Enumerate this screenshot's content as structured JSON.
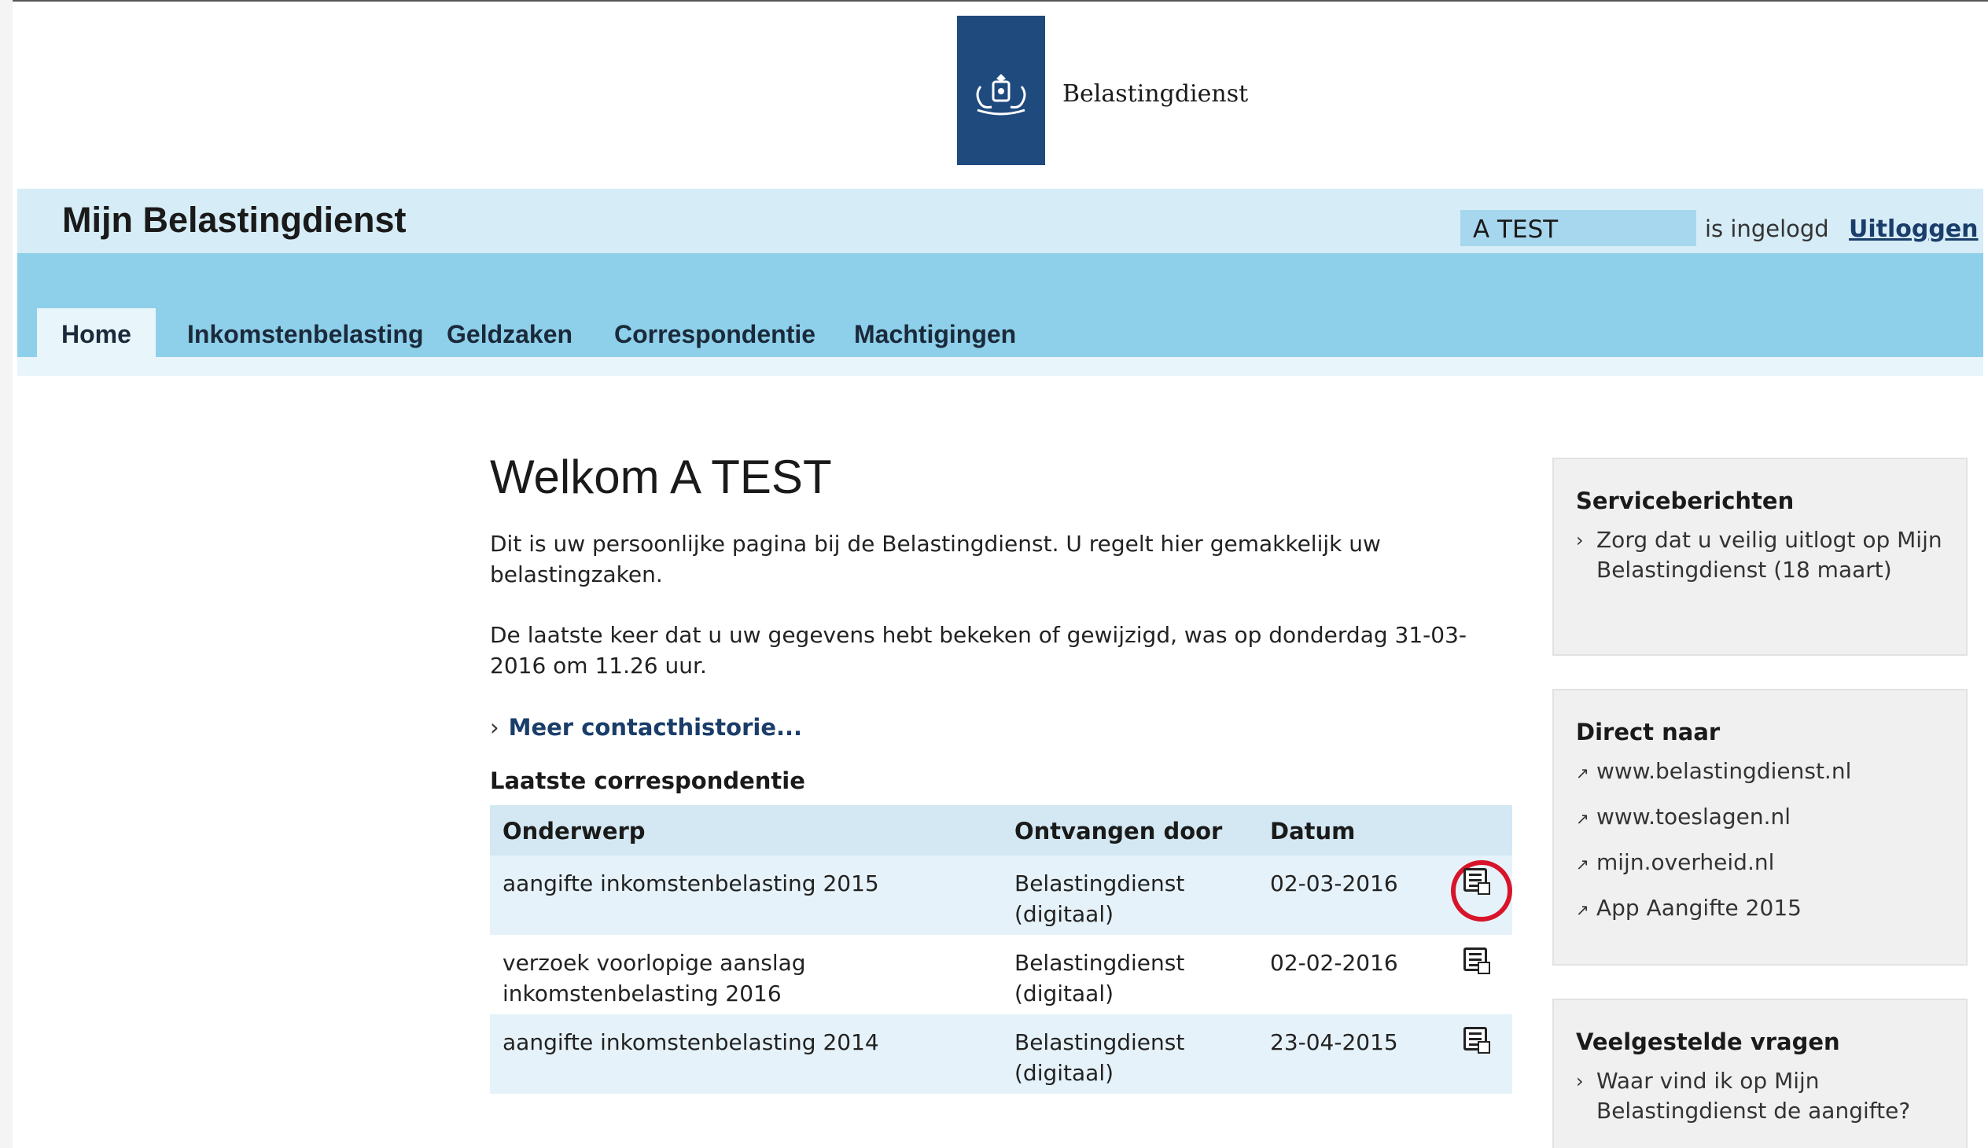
{
  "branding": {
    "org_name": "Belastingdienst"
  },
  "header": {
    "site_title": "Mijn Belastingdienst",
    "user_name": "A TEST",
    "logged_in_text": "is ingelogd",
    "logout_label": "Uitloggen"
  },
  "nav": {
    "tabs": [
      {
        "label": "Home",
        "active": true
      },
      {
        "label": "Inkomstenbelasting",
        "active": false
      },
      {
        "label": "Geldzaken",
        "active": false
      },
      {
        "label": "Correspondentie",
        "active": false
      },
      {
        "label": "Machtigingen",
        "active": false
      }
    ]
  },
  "main": {
    "welcome_prefix": "Welkom",
    "welcome_name": "A TEST",
    "intro": "Dit is uw persoonlijke pagina bij de Belastingdienst. U regelt hier gemakkelijk uw belastingzaken.",
    "last_visit": "De laatste keer dat u uw gegevens hebt bekeken of gewijzigd, was op donderdag 31-03-2016 om 11.26 uur.",
    "contact_history_link": "Meer contacthistorie...",
    "correspondence_heading": "Laatste correspondentie",
    "table": {
      "headers": [
        "Onderwerp",
        "Ontvangen door",
        "Datum"
      ],
      "rows": [
        {
          "subject": "aangifte inkomstenbelasting 2015",
          "received_by": "Belastingdienst (digitaal)",
          "date": "02-03-2016",
          "icon": "document-pdf-icon",
          "highlighted": true
        },
        {
          "subject": "verzoek voorlopige aanslag inkomstenbelasting 2016",
          "received_by": "Belastingdienst (digitaal)",
          "date": "02-02-2016",
          "icon": "document-pdf-icon",
          "highlighted": false
        },
        {
          "subject": "aangifte inkomstenbelasting 2014",
          "received_by": "Belastingdienst (digitaal)",
          "date": "23-04-2015",
          "icon": "document-pdf-icon",
          "highlighted": false
        }
      ]
    }
  },
  "sidebar": {
    "service_messages": {
      "title": "Serviceberichten",
      "items": [
        "Zorg dat u veilig uitlogt op Mijn Belastingdienst (18 maart)"
      ]
    },
    "direct_links": {
      "title": "Direct naar",
      "items": [
        "www.belastingdienst.nl",
        "www.toeslagen.nl",
        "mijn.overheid.nl",
        "App Aangifte 2015"
      ]
    },
    "faq": {
      "title": "Veelgestelde vragen",
      "items": [
        "Waar vind ik op Mijn Belastingdienst de aangifte?"
      ]
    }
  },
  "colors": {
    "logo_blue": "#1f4a7d",
    "header_light": "#d6ecf7",
    "nav_blue": "#8ecfea",
    "highlight_red": "#d7142a"
  }
}
